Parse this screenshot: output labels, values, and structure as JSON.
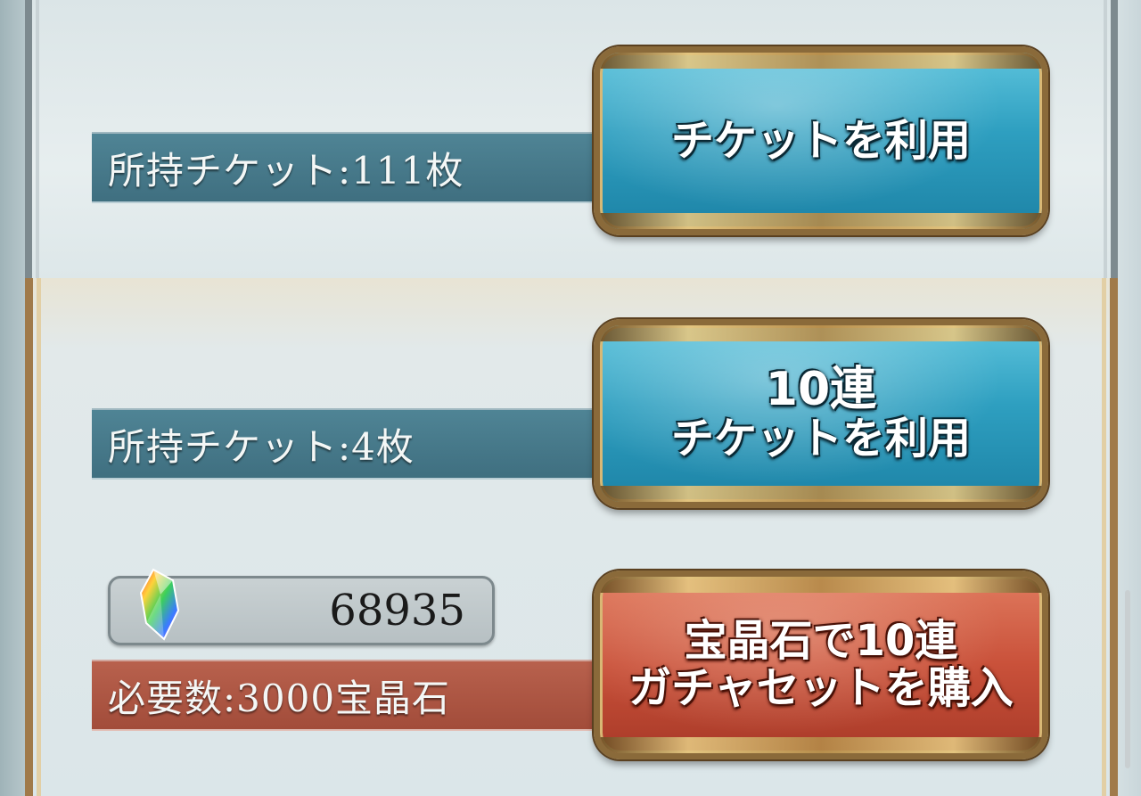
{
  "ticket_single": {
    "owned_label": "所持チケット:111枚",
    "button_label": "チケットを利用"
  },
  "ticket_ten": {
    "owned_label": "所持チケット:4枚",
    "button_line1": "10連",
    "button_line2": "チケットを利用"
  },
  "gem_purchase": {
    "gem_count": "68935",
    "required_label": "必要数:3000宝晶石",
    "button_line1": "宝晶石で10連",
    "button_line2": "ガチャセットを購入"
  },
  "colors": {
    "blue_button": "#2e9fc0",
    "red_button": "#c9513a",
    "gold_frame": "#d8b875"
  }
}
